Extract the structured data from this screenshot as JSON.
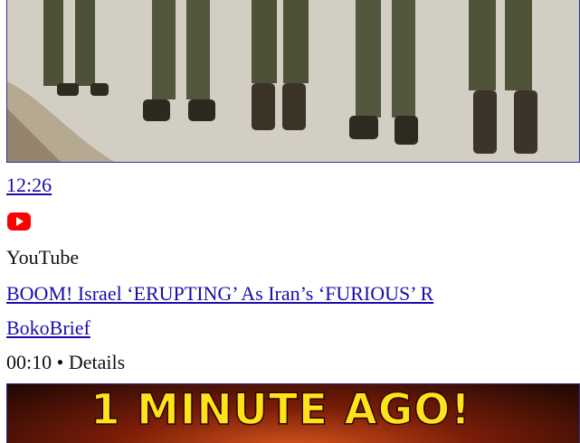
{
  "result": {
    "duration": "12:26",
    "source_icon": "youtube-play-icon",
    "source": "YouTube",
    "title": "BOOM! Israel ‘ERUPTING’ As Iran’s ‘FURIOUS’ R",
    "channel": "BokoBrief",
    "meta": "00:10 • Details"
  },
  "next_thumbnail": {
    "banner_text": "1 MINUTE AGO!"
  },
  "colors": {
    "link": "#1a0dab",
    "youtube_red": "#ff0000",
    "banner_yellow": "#ffe21a",
    "border": "#2d2f9f"
  }
}
